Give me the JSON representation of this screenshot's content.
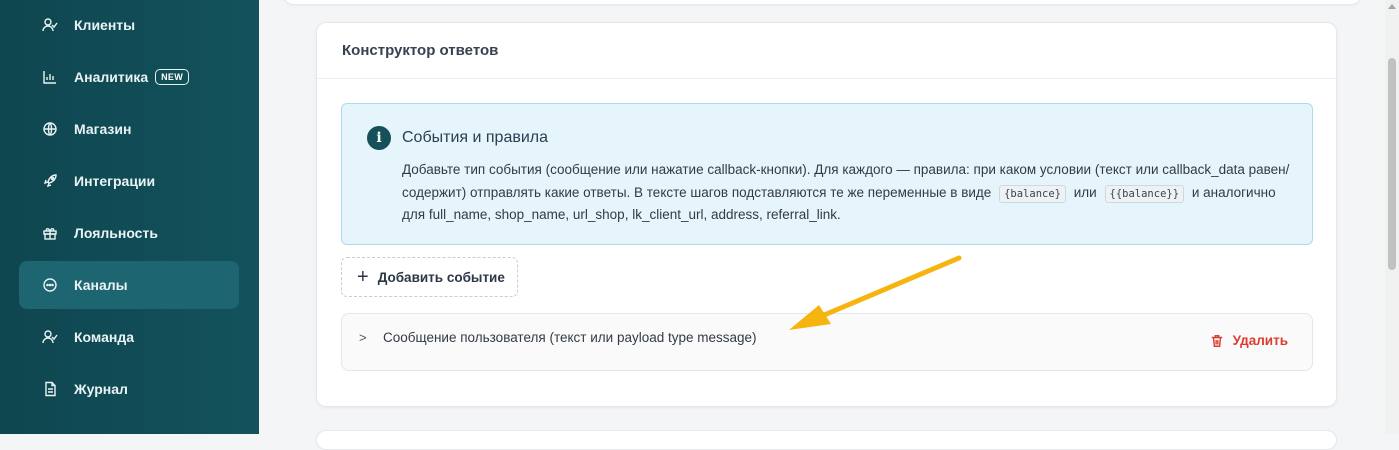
{
  "sidebar": {
    "items": [
      {
        "label": "Клиенты",
        "icon": "users-icon",
        "active": false
      },
      {
        "label": "Аналитика",
        "icon": "chart-icon",
        "badge": "NEW",
        "active": false
      },
      {
        "label": "Магазин",
        "icon": "globe-icon",
        "active": false
      },
      {
        "label": "Интеграции",
        "icon": "rocket-icon",
        "active": false
      },
      {
        "label": "Лояльность",
        "icon": "gift-icon",
        "active": false
      },
      {
        "label": "Каналы",
        "icon": "chat-icon",
        "active": true
      },
      {
        "label": "Команда",
        "icon": "team-icon",
        "active": false
      },
      {
        "label": "Журнал",
        "icon": "document-icon",
        "active": false
      }
    ]
  },
  "card": {
    "title": "Конструктор ответов",
    "info": {
      "title": "События и правила",
      "text_1": "Добавьте тип события (сообщение или нажатие callback-кнопки). Для каждого — правила: при каком условии (текст или callback_data равен/содержит) отправлять какие ответы. В тексте шагов подставляются те же переменные в виде",
      "code_1": "{balance}",
      "text_or": "или",
      "code_2": "{{balance}}",
      "text_2": "и аналогично для full_name, shop_name, url_shop, lk_client_url, address, referral_link."
    },
    "add_event_label": "Добавить событие",
    "event": {
      "label": "Сообщение пользователя (текст или payload type message)",
      "delete_label": "Удалить"
    }
  },
  "colors": {
    "sidebar_bg": "#13525c",
    "accent": "#15505b",
    "info_bg": "#e6f5fc",
    "danger": "#dc3b2f",
    "annotation_arrow": "#f5b40f"
  }
}
